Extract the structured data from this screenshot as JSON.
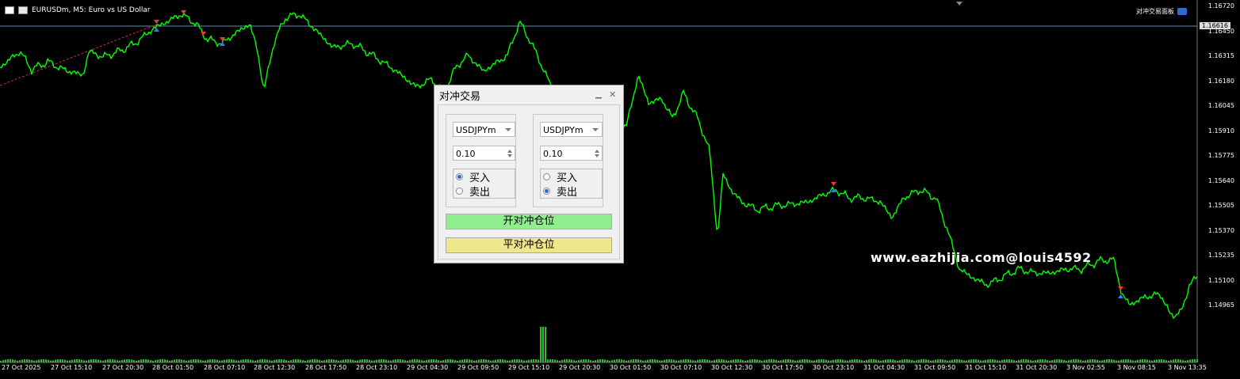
{
  "header": {
    "title": "EURUSDm, M5:  Euro vs US Dollar"
  },
  "ea_name": "对冲交易面板",
  "watermark": "www.eazhijia.com@louis4592",
  "current_price": "1.16616",
  "price_labels": [
    "1.16720",
    "1.16450",
    "1.16315",
    "1.16180",
    "1.16045",
    "1.15910",
    "1.15775",
    "1.15640",
    "1.15505",
    "1.15370",
    "1.15235",
    "1.15100",
    "1.14965"
  ],
  "time_labels": [
    "27 Oct 2025",
    "27 Oct 15:10",
    "27 Oct 20:30",
    "28 Oct 01:50",
    "28 Oct 07:10",
    "28 Oct 12:30",
    "28 Oct 17:50",
    "28 Oct 23:10",
    "29 Oct 04:30",
    "29 Oct 09:50",
    "29 Oct 15:10",
    "29 Oct 20:30",
    "30 Oct 01:50",
    "30 Oct 07:10",
    "30 Oct 12:30",
    "30 Oct 17:50",
    "30 Oct 23:10",
    "31 Oct 04:30",
    "31 Oct 09:50",
    "31 Oct 15:10",
    "31 Oct 20:30",
    "3 Nov 02:55",
    "3 Nov 08:15",
    "3 Nov 13:35"
  ],
  "colors": {
    "price_line": "#00ff00",
    "volume": "#2bbf2b",
    "open_button": "#90ee90",
    "close_button": "#f0e68c",
    "current_line": "#6c8ca8"
  },
  "dialog": {
    "title": "对冲交易",
    "left": {
      "symbol": "USDJPYm",
      "lot": "0.10",
      "buy_label": "买入",
      "sell_label": "卖出",
      "selected": "buy"
    },
    "right": {
      "symbol": "USDJPYm",
      "lot": "0.10",
      "buy_label": "买入",
      "sell_label": "卖出",
      "selected": "sell"
    },
    "open_button": "开对冲仓位",
    "close_button": "平对冲仓位"
  }
}
